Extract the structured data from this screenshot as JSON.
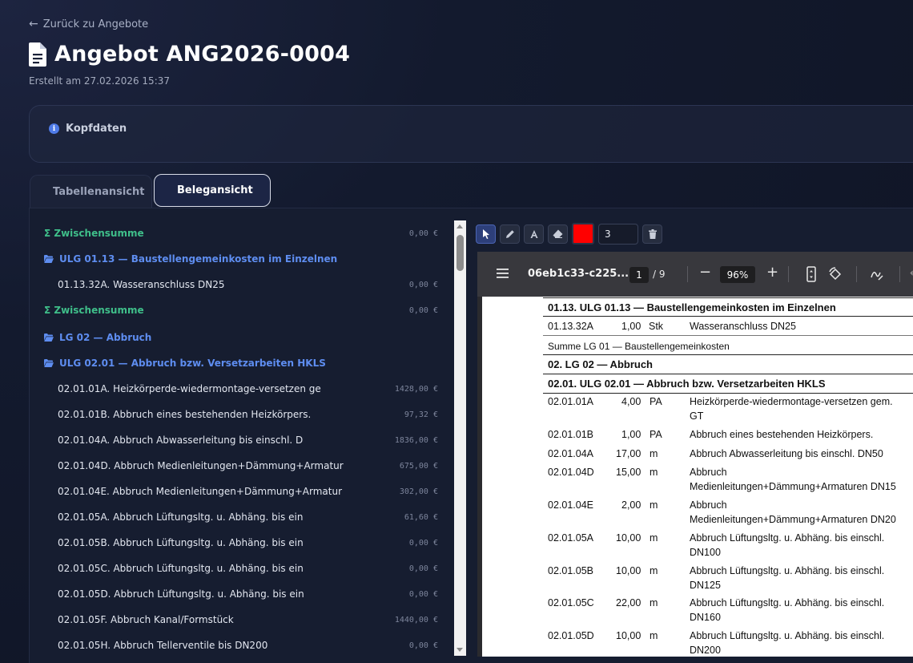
{
  "nav": {
    "back_label": "Zurück zu Angebote"
  },
  "header": {
    "title": "Angebot ANG2026-0004",
    "created": "Erstellt am 27.02.2026 15:37"
  },
  "kopf": {
    "title": "Kopfdaten"
  },
  "tabs": [
    {
      "label": "Tabellenansicht",
      "active": false
    },
    {
      "label": "Belegansicht",
      "active": true
    }
  ],
  "list": [
    {
      "type": "sum",
      "label": "Σ Zwischensumme",
      "amount": "0,00 €"
    },
    {
      "type": "group",
      "label": "ULG 01.13 — Baustellengemeinkosten im Einzelnen",
      "amount": ""
    },
    {
      "type": "item",
      "label": "01.13.32A. Wasseranschluss DN25",
      "amount": "0,00 €"
    },
    {
      "type": "sum",
      "label": "Σ Zwischensumme",
      "amount": "0,00 €"
    },
    {
      "type": "group",
      "label": "LG 02 — Abbruch",
      "amount": ""
    },
    {
      "type": "group",
      "label": "ULG 02.01 — Abbruch bzw. Versetzarbeiten HKLS",
      "amount": ""
    },
    {
      "type": "item",
      "label": "02.01.01A. Heizkörperde-wiedermontage-versetzen ge",
      "amount": "1428,00 €"
    },
    {
      "type": "item",
      "label": "02.01.01B. Abbruch eines bestehenden Heizkörpers.",
      "amount": "97,32 €"
    },
    {
      "type": "item",
      "label": "02.01.04A. Abbruch Abwasserleitung bis einschl. D",
      "amount": "1836,00 €"
    },
    {
      "type": "item",
      "label": "02.01.04D. Abbruch Medienleitungen+Dämmung+Armatur",
      "amount": "675,00 €"
    },
    {
      "type": "item",
      "label": "02.01.04E. Abbruch Medienleitungen+Dämmung+Armatur",
      "amount": "302,00 €"
    },
    {
      "type": "item",
      "label": "02.01.05A. Abbruch Lüftungsltg. u. Abhäng. bis ein",
      "amount": "61,60 €"
    },
    {
      "type": "item",
      "label": "02.01.05B. Abbruch Lüftungsltg. u. Abhäng. bis ein",
      "amount": "0,00 €"
    },
    {
      "type": "item",
      "label": "02.01.05C. Abbruch Lüftungsltg. u. Abhäng. bis ein",
      "amount": "0,00 €"
    },
    {
      "type": "item",
      "label": "02.01.05D. Abbruch Lüftungsltg. u. Abhäng. bis ein",
      "amount": "0,00 €"
    },
    {
      "type": "item",
      "label": "02.01.05F. Abbruch Kanal/Formstück",
      "amount": "1440,00 €"
    },
    {
      "type": "item",
      "label": "02.01.05H. Abbruch Tellerventile bis DN200",
      "amount": "0,00 €"
    }
  ],
  "tools": {
    "stroke_width": "3",
    "color": "#ff0000"
  },
  "pdf": {
    "filename": "06eb1c33-c225...",
    "page": "1",
    "page_count": "/ 9",
    "zoom": "96%",
    "heading1": "01.13. ULG 01.13 — Baustellengemeinkosten im Einzelnen",
    "line_a": {
      "code": "01.13.32A",
      "qty": "1,00",
      "unit": "Stk",
      "desc": "Wasseranschluss DN25"
    },
    "summe": "Summe LG 01 — Baustellengemeinkosten",
    "heading2": "02. LG 02 — Abbruch",
    "heading3": "02.01. ULG 02.01 — Abbruch bzw. Versetzarbeiten HKLS",
    "rows": [
      {
        "code": "02.01.01A",
        "qty": "4,00",
        "unit": "PA",
        "desc1": "Heizkörperde-wiedermontage-versetzen gem.",
        "desc2": "GT"
      },
      {
        "code": "02.01.01B",
        "qty": "1,00",
        "unit": "PA",
        "desc1": "Abbruch eines bestehenden Heizkörpers.",
        "desc2": ""
      },
      {
        "code": "02.01.04A",
        "qty": "17,00",
        "unit": "m",
        "desc1": "Abbruch Abwasserleitung bis einschl. DN50",
        "desc2": ""
      },
      {
        "code": "02.01.04D",
        "qty": "15,00",
        "unit": "m",
        "desc1": "Abbruch",
        "desc2": "Medienleitungen+Dämmung+Armaturen DN15"
      },
      {
        "code": "02.01.04E",
        "qty": "2,00",
        "unit": "m",
        "desc1": "Abbruch",
        "desc2": "Medienleitungen+Dämmung+Armaturen DN20"
      },
      {
        "code": "02.01.05A",
        "qty": "10,00",
        "unit": "m",
        "desc1": "Abbruch Lüftungsltg. u. Abhäng. bis einschl.",
        "desc2": "DN100"
      },
      {
        "code": "02.01.05B",
        "qty": "10,00",
        "unit": "m",
        "desc1": "Abbruch Lüftungsltg. u. Abhäng. bis einschl.",
        "desc2": "DN125"
      },
      {
        "code": "02.01.05C",
        "qty": "22,00",
        "unit": "m",
        "desc1": "Abbruch Lüftungsltg. u. Abhäng. bis einschl.",
        "desc2": "DN160"
      },
      {
        "code": "02.01.05D",
        "qty": "10,00",
        "unit": "m",
        "desc1": "Abbruch Lüftungsltg. u. Abhäng. bis einschl.",
        "desc2": "DN200"
      }
    ]
  }
}
